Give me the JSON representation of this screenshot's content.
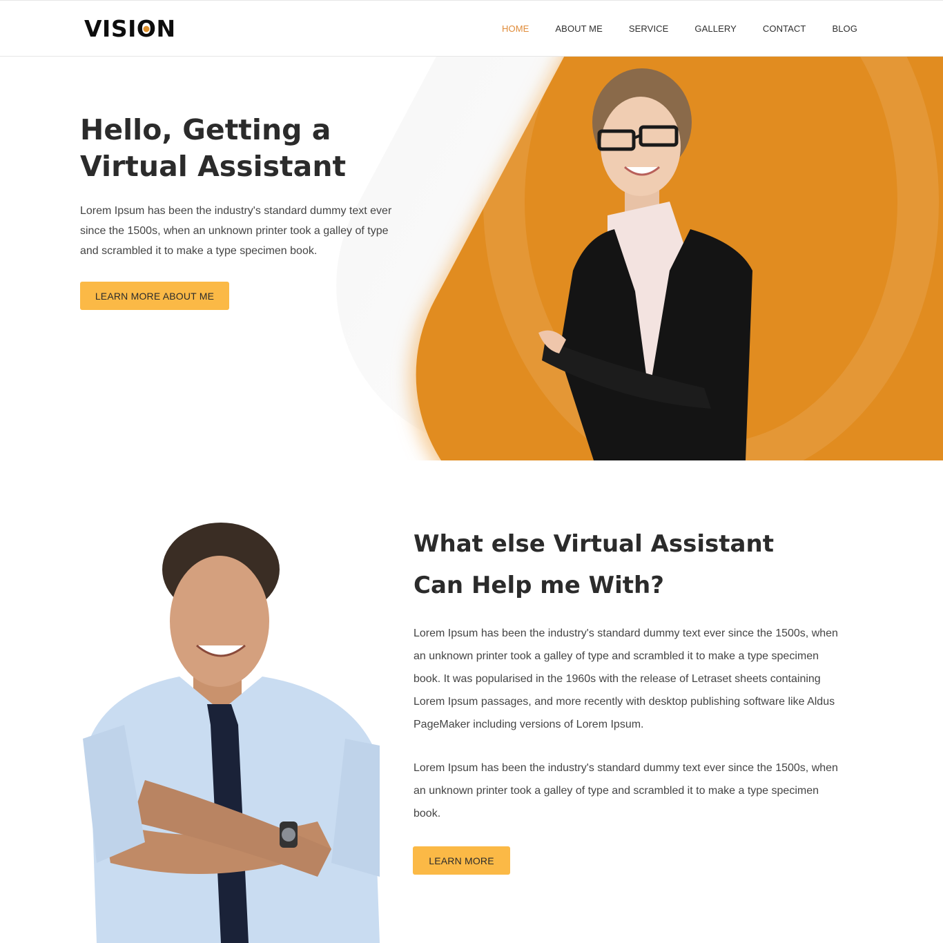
{
  "brand": {
    "logo_text_before": "VISI",
    "logo_letter_o": "O",
    "logo_text_after": "N",
    "accent_color": "#e18c20",
    "button_color": "#fbb946",
    "active_nav_color": "#e08b38"
  },
  "nav": {
    "items": [
      {
        "label": "HOME",
        "active": true
      },
      {
        "label": "ABOUT ME",
        "active": false
      },
      {
        "label": "SERVICE",
        "active": false
      },
      {
        "label": "GALLERY",
        "active": false
      },
      {
        "label": "CONTACT",
        "active": false
      },
      {
        "label": "BLOG",
        "active": false
      }
    ]
  },
  "hero": {
    "title_line1": "Hello, Getting a",
    "title_line2": "Virtual Assistant",
    "text": "Lorem Ipsum has been the industry's standard dummy text ever since the 1500s, when an unknown printer took a galley of type and scrambled it to make a type specimen book.",
    "button_label": "LEARN MORE ABOUT ME",
    "image": "businesswoman-photo"
  },
  "section2": {
    "title": "What else Virtual Assistant Can Help me With?",
    "paragraph1": "Lorem Ipsum has been the industry's standard dummy text ever since the 1500s, when an unknown printer took a galley of type and scrambled it to make a type specimen book. It was popularised in the 1960s with the release of Letraset sheets containing Lorem Ipsum passages, and more recently with desktop publishing software like Aldus PageMaker including versions of Lorem Ipsum.",
    "paragraph2": "Lorem Ipsum has been the industry's standard dummy text ever since the 1500s, when an unknown printer took a galley of type and scrambled it to make a type specimen book.",
    "button_label": "LEARN MORE",
    "image": "businessman-photo"
  }
}
